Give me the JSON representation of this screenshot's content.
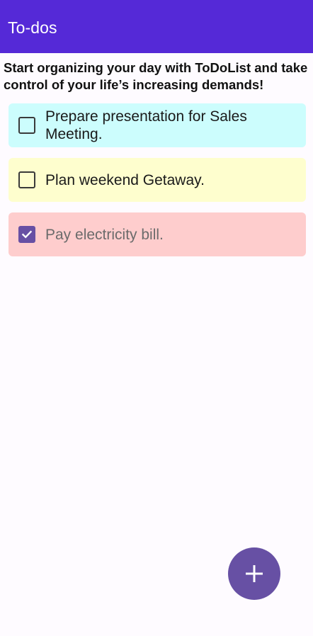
{
  "app_bar": {
    "title": "To-dos",
    "color": "#5529d7"
  },
  "subtitle": "Start organizing your day with ToDoList and take control of your life’s increasing demands!",
  "todos": [
    {
      "text": "Prepare presentation for Sales Meeting.",
      "checked": false,
      "color": "#ccfdfd"
    },
    {
      "text": "Plan weekend Getaway.",
      "checked": false,
      "color": "#fefece"
    },
    {
      "text": "Pay electricity bill.",
      "checked": true,
      "color": "#fecdcd"
    }
  ],
  "fab": {
    "icon": "plus-icon",
    "color": "#6750a4"
  }
}
